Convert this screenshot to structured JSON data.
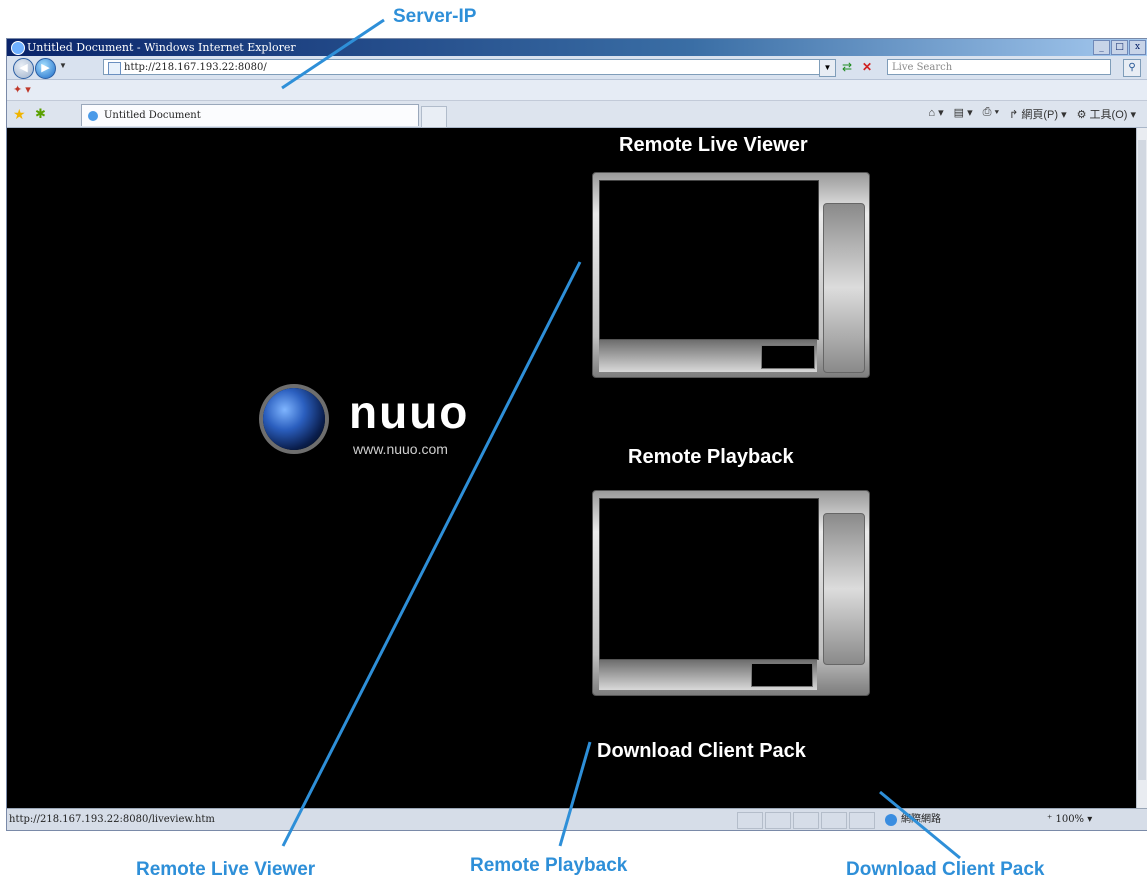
{
  "browser": {
    "window_title": "Untitled Document - Windows Internet Explorer",
    "window_buttons": [
      "_",
      "□",
      "x"
    ],
    "address_url": "http://218.167.193.22:8080/",
    "search_placeholder": "Live Search",
    "tab_title": "Untitled Document",
    "command_bar": [
      "⌂ ▾",
      "▤ ▾",
      "⎙ ▾",
      "↱ 網頁(P) ▾",
      "⚙ 工具(O) ▾"
    ],
    "status_url": "http://218.167.193.22:8080/liveview.htm",
    "status_zone": "網際網路",
    "zoom": "100%",
    "icons": [
      "back-icon",
      "forward-icon",
      "refresh-icon",
      "stop-icon",
      "search-icon",
      "favorites-star-icon",
      "add-favorite-icon",
      "home-icon",
      "globe-icon"
    ]
  },
  "page": {
    "logo_text": "nuuo",
    "logo_url": "www.nuuo.com",
    "live_viewer_title": "Remote Live Viewer",
    "playback_title": "Remote Playback",
    "download_title": "Download Client Pack"
  },
  "annotations": {
    "server_ip": "Server-IP",
    "remote_live_viewer": "Remote Live Viewer",
    "remote_playback": "Remote Playback",
    "download_client_pack": "Download Client Pack",
    "color": "#2e8fd8"
  }
}
